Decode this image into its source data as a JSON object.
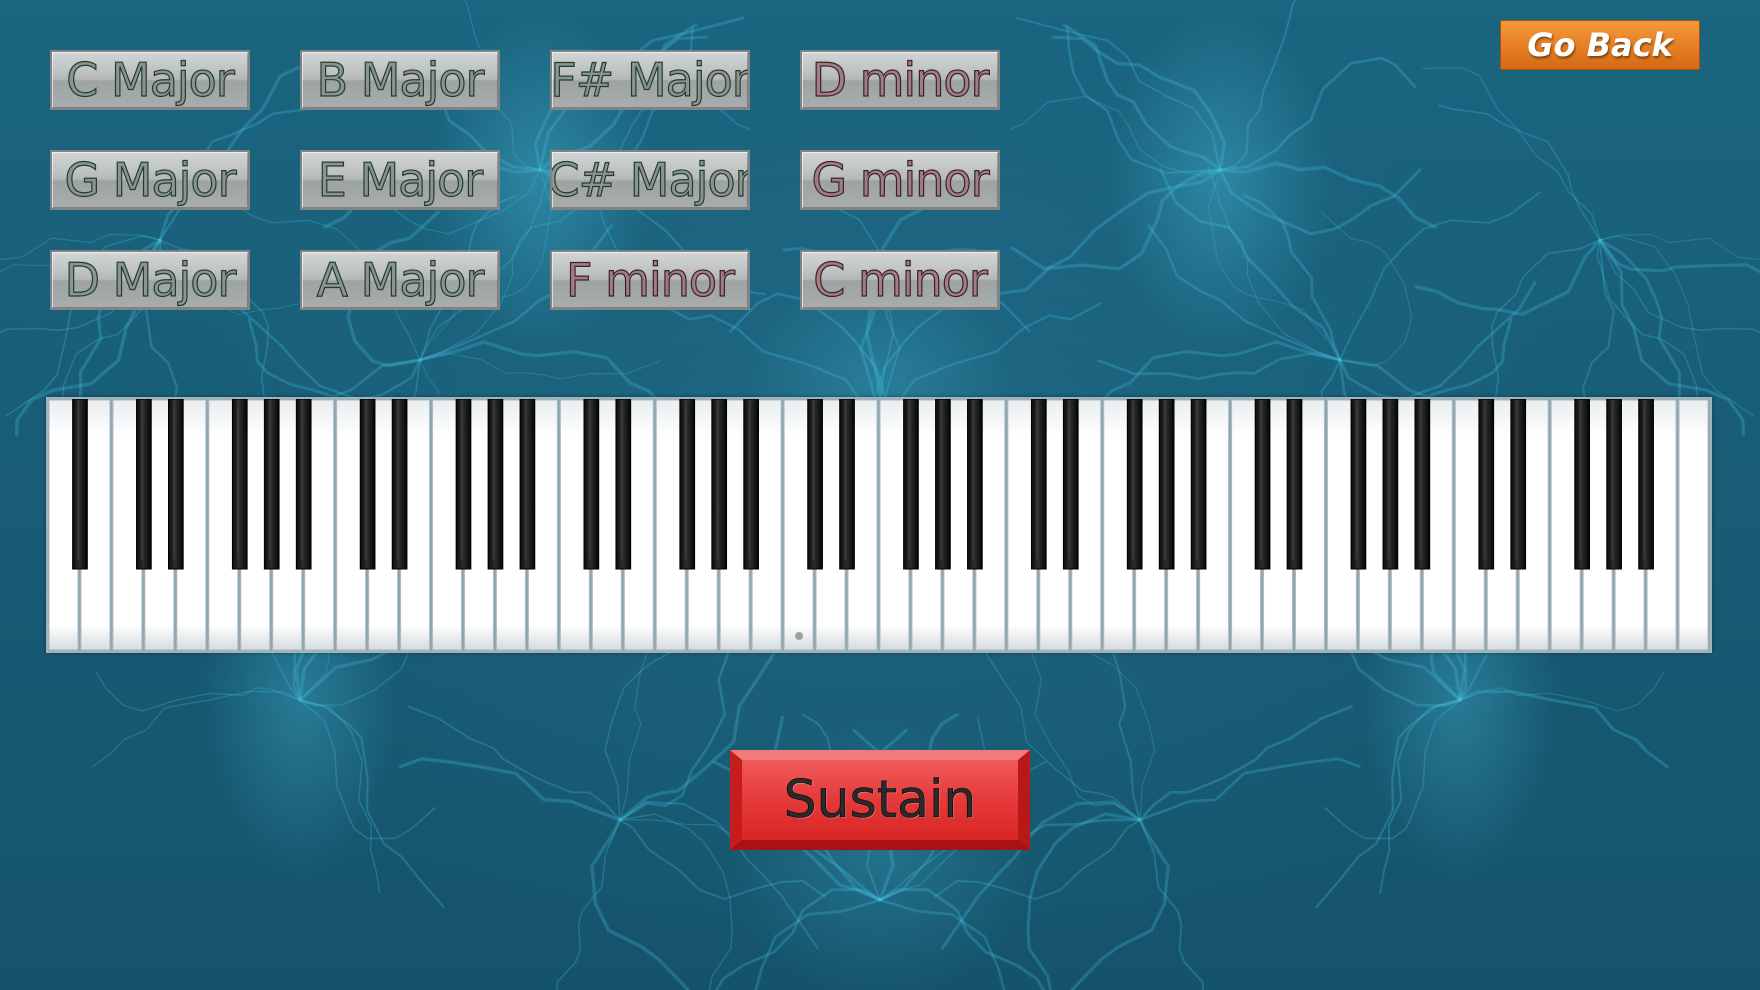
{
  "chords": [
    {
      "label": "C Major",
      "quality": "major"
    },
    {
      "label": "B Major",
      "quality": "major"
    },
    {
      "label": "F# Major",
      "quality": "major"
    },
    {
      "label": "D minor",
      "quality": "minor"
    },
    {
      "label": "G Major",
      "quality": "major"
    },
    {
      "label": "E Major",
      "quality": "major"
    },
    {
      "label": "C# Major",
      "quality": "major"
    },
    {
      "label": "G minor",
      "quality": "minor"
    },
    {
      "label": "D Major",
      "quality": "major"
    },
    {
      "label": "A Major",
      "quality": "major"
    },
    {
      "label": "F minor",
      "quality": "minor"
    },
    {
      "label": "C minor",
      "quality": "minor"
    }
  ],
  "go_back_label": "Go Back",
  "sustain_label": "Sustain",
  "piano": {
    "keys": 88,
    "white_keys": 52,
    "black_keys": 36,
    "lowest_note": "A0",
    "highest_note": "C8",
    "marked_key": "C4"
  },
  "colors": {
    "background": "#175a72",
    "chord_button": "#b6baba",
    "go_back": "#e67e22",
    "sustain": "#e53a3a"
  }
}
